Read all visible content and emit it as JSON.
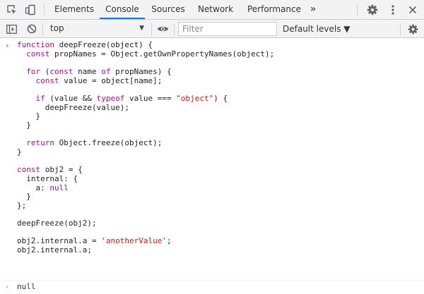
{
  "tabs": [
    {
      "label": "Elements"
    },
    {
      "label": "Console"
    },
    {
      "label": "Sources"
    },
    {
      "label": "Network"
    },
    {
      "label": "Performance"
    }
  ],
  "more_tabs_label": "»",
  "toolbar": {
    "context": "top",
    "filter_placeholder": "Filter",
    "levels_label": "Default levels ▼"
  },
  "console": {
    "prompt_glyph": "›",
    "result_glyph": "‹",
    "code_lines": [
      "function deepFreeze(object) {",
      "  const propNames = Object.getOwnPropertyNames(object);",
      "",
      "  for (const name of propNames) {",
      "    const value = object[name];",
      "",
      "    if (value && typeof value === \"object\") {",
      "      deepFreeze(value);",
      "    }",
      "  }",
      "",
      "  return Object.freeze(object);",
      "}",
      "",
      "const obj2 = {",
      "  internal: {",
      "    a: null",
      "  }",
      "};",
      "",
      "deepFreeze(obj2);",
      "",
      "obj2.internal.a = 'anotherValue';",
      "obj2.internal.a;"
    ],
    "result": "null"
  },
  "colors": {
    "keyword": "#aa0d91",
    "string": "#c41a16",
    "accent": "#1a73e8"
  },
  "icons": [
    "inspect-icon",
    "device-toggle-icon",
    "more-tabs-icon",
    "settings-icon",
    "kebab-menu-icon",
    "close-icon",
    "sidebar-toggle-icon",
    "clear-console-icon",
    "eye-icon",
    "console-settings-icon"
  ]
}
